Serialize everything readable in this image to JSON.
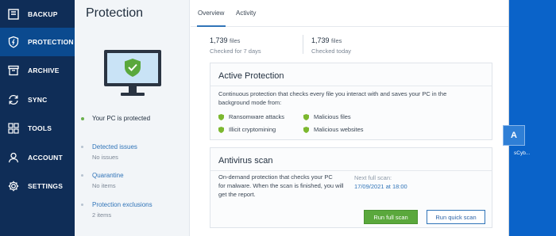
{
  "nav": {
    "items": [
      {
        "label": "BACKUP",
        "icon": "backup-icon"
      },
      {
        "label": "PROTECTION",
        "icon": "shield-icon",
        "active": true
      },
      {
        "label": "ARCHIVE",
        "icon": "archive-icon"
      },
      {
        "label": "SYNC",
        "icon": "sync-icon"
      },
      {
        "label": "TOOLS",
        "icon": "tools-grid-icon"
      },
      {
        "label": "ACCOUNT",
        "icon": "user-icon"
      },
      {
        "label": "SETTINGS",
        "icon": "gear-icon"
      }
    ]
  },
  "mid": {
    "title": "Protection",
    "status": "Your PC is protected",
    "links": [
      {
        "label": "Detected issues",
        "sub": "No issues"
      },
      {
        "label": "Quarantine",
        "sub": "No items"
      },
      {
        "label": "Protection exclusions",
        "sub": "2 items"
      }
    ]
  },
  "tabs": [
    {
      "label": "Overview",
      "active": true
    },
    {
      "label": "Activity"
    }
  ],
  "stats": [
    {
      "value": "1,739",
      "unit": "files",
      "sub": "Checked for 7 days"
    },
    {
      "value": "1,739",
      "unit": "files",
      "sub": "Checked today"
    }
  ],
  "active_protection": {
    "title": "Active Protection",
    "description_line1": "Continuous protection that checks every file you interact with and saves your PC in the",
    "description_line2": "background mode from:",
    "features": [
      "Ransomware attacks",
      "Illicit cryptomining",
      "Malicious files",
      "Malicious websites"
    ]
  },
  "antivirus": {
    "title": "Antivirus scan",
    "desc_line1": "On-demand protection that checks your PC",
    "desc_line2": "for malware. When the scan is finished, you will",
    "desc_line3": "get the report.",
    "next_label": "Next full scan:",
    "next_value": "17/09/2021 at 18:00",
    "run_full": "Run full scan",
    "run_quick": "Run quick scan"
  },
  "desktop": {
    "icon_glyph": "A",
    "icon_label": "sCyb..."
  },
  "colors": {
    "nav_bg": "#0f2d57",
    "nav_active": "#0b4a8f",
    "accent_blue": "#3074b8",
    "green": "#5aa83c",
    "desktop_blue": "#0a63c9"
  }
}
